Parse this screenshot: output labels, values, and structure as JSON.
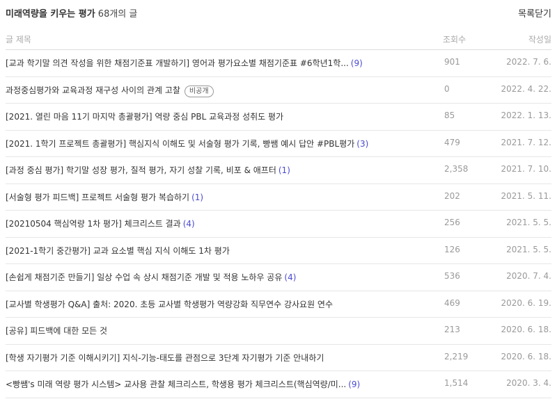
{
  "header": {
    "category": "미래역량을 키우는 평가",
    "count_num": "68",
    "count_suffix": "개의 글",
    "close_label": "목록닫기"
  },
  "columns": {
    "title": "글 제목",
    "views": "조회수",
    "date": "작성일"
  },
  "rows": [
    {
      "title": "[교과 학기말 의견 작성을 위한 채점기준표 개발하기] 영어과 평가요소별 채점기준표 #6학년1학...",
      "comments": "(9)",
      "badge": "",
      "views": "901",
      "date": "2022. 7. 6."
    },
    {
      "title": "과정중심평가와 교육과정 재구성 사이의 관계 고찰",
      "comments": "",
      "badge": "비공개",
      "views": "0",
      "date": "2022. 4. 22."
    },
    {
      "title": "[2021. 열린 마음 11기 마지막 총괄평가] 역량 중심 PBL 교육과정 성취도 평가",
      "comments": "",
      "badge": "",
      "views": "85",
      "date": "2022. 1. 13."
    },
    {
      "title": "[2021. 1학기 프로젝트 총괄평가] 핵심지식 이해도 및 서술형 평가 기록, 빵쌤 예시 답안 #PBL평가",
      "comments": "(3)",
      "badge": "",
      "views": "479",
      "date": "2021. 7. 12."
    },
    {
      "title": "[과정 중심 평가] 학기말 성장 평가, 질적 평가, 자기 성찰 기록, 비포 & 애프터",
      "comments": "(1)",
      "badge": "",
      "views": "2,358",
      "date": "2021. 7. 10."
    },
    {
      "title": "[서술형 평가 피드백] 프로젝트 서술형 평가 복습하기",
      "comments": "(1)",
      "badge": "",
      "views": "202",
      "date": "2021. 5. 11."
    },
    {
      "title": "[20210504 핵심역량 1차 평가] 체크리스트 결과",
      "comments": "(4)",
      "badge": "",
      "views": "256",
      "date": "2021. 5. 5."
    },
    {
      "title": "[2021-1학기 중간평가] 교과 요소별 핵심 지식 이해도 1차 평가",
      "comments": "",
      "badge": "",
      "views": "126",
      "date": "2021. 5. 5."
    },
    {
      "title": "[손쉽게 채점기준 만들기] 일상 수업 속 상시 채점기준 개발 및 적용 노하우 공유",
      "comments": "(4)",
      "badge": "",
      "views": "536",
      "date": "2020. 7. 4."
    },
    {
      "title": "[교사별 학생평가 Q&A] 출처: 2020. 초등 교사별 학생평가 역량강화 직무연수 강사요원 연수",
      "comments": "",
      "badge": "",
      "views": "469",
      "date": "2020. 6. 19."
    },
    {
      "title": "[공유] 피드백에 대한 모든 것",
      "comments": "",
      "badge": "",
      "views": "213",
      "date": "2020. 6. 18."
    },
    {
      "title": "[학생 자기평가 기준 이해시키기] 지식-기능-태도를 관점으로 3단계 자기평가 기준 안내하기",
      "comments": "",
      "badge": "",
      "views": "2,219",
      "date": "2020. 6. 18."
    },
    {
      "title": "<빵쌤's 미래 역량 평가 시스템> 교사용 관찰 체크리스트, 학생용 평가 체크리스트(핵심역량/미...",
      "comments": "(9)",
      "badge": "",
      "views": "1,514",
      "date": "2020. 3. 4."
    }
  ]
}
